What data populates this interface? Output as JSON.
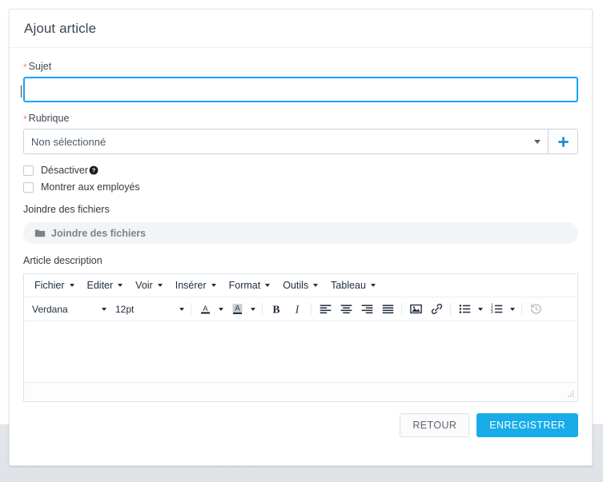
{
  "card": {
    "title": "Ajout article"
  },
  "form": {
    "subject": {
      "label": "Sujet",
      "required_marker": "*",
      "value": "",
      "placeholder": ""
    },
    "rubrique": {
      "label": "Rubrique",
      "required_marker": "*",
      "selected": "Non sélectionné",
      "add_button_title": "+"
    },
    "checkboxes": [
      {
        "label": "Désactiver",
        "checked": false,
        "help": "?"
      },
      {
        "label": "Montrer aux employés",
        "checked": false
      }
    ],
    "attachments": {
      "label": "Joindre des fichiers",
      "button_label": "Joindre des fichiers"
    },
    "description": {
      "label": "Article description",
      "content": ""
    }
  },
  "editor": {
    "menus": [
      {
        "label": "Fichier"
      },
      {
        "label": "Editer"
      },
      {
        "label": "Voir"
      },
      {
        "label": "Insérer"
      },
      {
        "label": "Format"
      },
      {
        "label": "Outils"
      },
      {
        "label": "Tableau"
      }
    ],
    "toolbar": {
      "font_family": "Verdana",
      "font_size": "12pt",
      "buttons": [
        "forecolor-icon",
        "backcolor-icon",
        "bold-icon",
        "italic-icon",
        "align-left-icon",
        "align-center-icon",
        "align-right-icon",
        "align-justify-icon",
        "image-icon",
        "link-icon",
        "bullist-icon",
        "numlist-icon",
        "restoredraft-icon"
      ]
    },
    "statusbar": ""
  },
  "footer": {
    "back_label": "RETOUR",
    "save_label": "ENREGISTRER"
  },
  "colors": {
    "accent": "#18ace9",
    "focus_border": "#12a5f4",
    "required": "#ff7b72",
    "page_bg": "#e2e6ea",
    "text": "#3b4650"
  }
}
